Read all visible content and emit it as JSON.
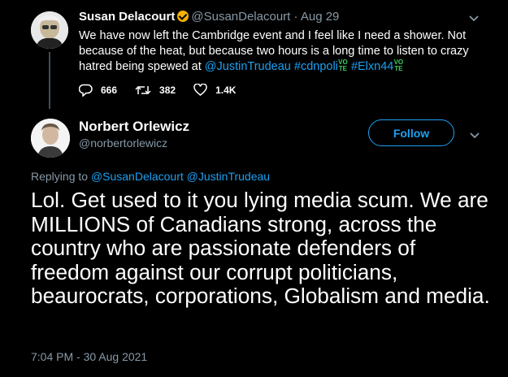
{
  "parent_tweet": {
    "name": "Susan Delacourt",
    "handle": "@SusanDelacourt",
    "separator": "·",
    "date": "Aug 29",
    "text_line1": "We have now left the Cambridge event and I feel like I need a shower. Not",
    "text_line2": "because of the heat, but because two hours is a long time to listen to crazy",
    "text_line3_prefix": "hatred being spewed at ",
    "mention": "@JustinTrudeau",
    "hashtag1": "#cdnpoli",
    "hashtag2": "#Elxn44",
    "vote_emoji": [
      "VO",
      "TE"
    ],
    "replies": "666",
    "retweets": "382",
    "likes": "1.4K"
  },
  "main_tweet": {
    "name": "Norbert Orlewicz",
    "handle": "@norbertorlewicz",
    "follow_label": "Follow",
    "replying_to_prefix": "Replying to ",
    "replying_to_1": "@SusanDelacourt",
    "replying_to_2": "@JustinTrudeau",
    "text": "Lol. Get used to it you lying media scum. We are MILLIONS of Canadians strong, across the country who are passionate defenders of freedom against our corrupt politicians, beaurocrats, corporations, Globalism and media.",
    "timestamp": "7:04 PM - 30 Aug 2021"
  },
  "icons": {
    "reply": "reply-icon",
    "retweet": "retweet-icon",
    "like": "heart-icon",
    "more": "chevron-down-icon",
    "verified": "verified-badge-icon"
  },
  "colors": {
    "background": "#000000",
    "accent": "#1da1f2",
    "muted": "#8899a6",
    "verified": "#f5b000"
  }
}
